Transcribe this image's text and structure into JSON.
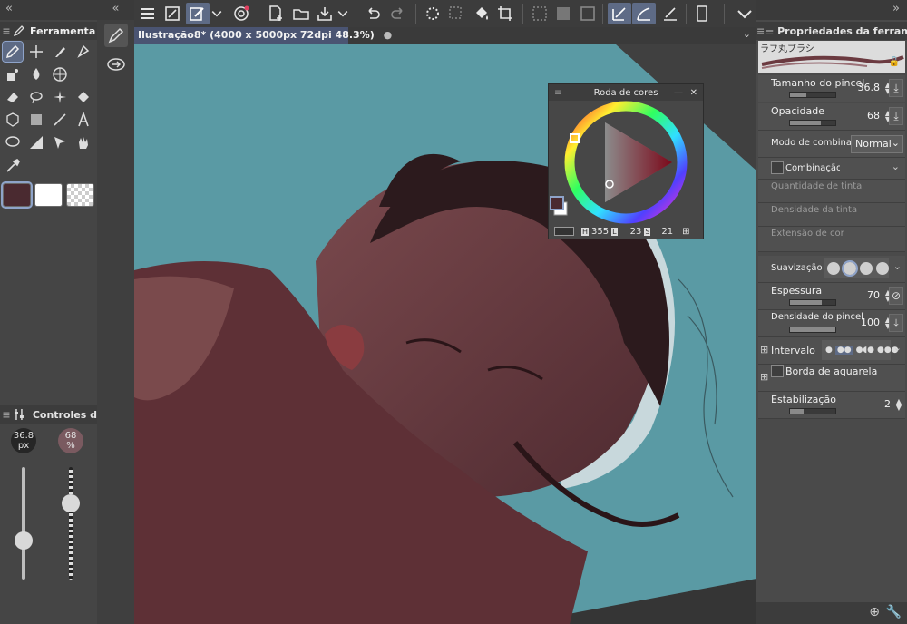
{
  "left_panel": {
    "tool_title": "Ferramenta",
    "controls_title": "Controles d",
    "brush_size": {
      "value": "36.8",
      "unit": "px",
      "fraction": 0.35
    },
    "opacity": {
      "value": "68",
      "unit": "%",
      "fraction": 0.68
    },
    "colors": {
      "main": "#4a2a30",
      "sub": "#ffffff"
    }
  },
  "document": {
    "tab_title": "Ilustração8* (4000 x 5000px 72dpi 48.3%)"
  },
  "color_wheel": {
    "title": "Roda de cores",
    "h_label": "H",
    "h_value": "355",
    "l_label": "L",
    "l_value": "23",
    "s_label": "S",
    "s_value": "21"
  },
  "properties": {
    "title": "Propriedades da ferramenta",
    "brush_name": "ラフ丸ブラシ",
    "items": {
      "brush_size": {
        "label": "Tamanho do pincel",
        "value": "36.8"
      },
      "opacity": {
        "label": "Opacidade",
        "value": "68"
      },
      "blend_mode": {
        "label": "Modo de combinação",
        "value": "Normal"
      },
      "color_blend": {
        "label": "Combinação de cor"
      },
      "paint_amount": {
        "label": "Quantidade de tinta"
      },
      "paint_density": {
        "label": "Densidade da tinta"
      },
      "color_stretch": {
        "label": "Extensão de cor"
      },
      "antialiasing": {
        "label": "Suavização de :"
      },
      "thickness": {
        "label": "Espessura",
        "value": "70"
      },
      "brush_density": {
        "label": "Densidade do pincel",
        "value": "100"
      },
      "interval": {
        "label": "Intervalo"
      },
      "watercolor_edge": {
        "label": "Borda de aquarela"
      },
      "stabilization": {
        "label": "Estabilização",
        "value": "2"
      }
    }
  },
  "colors": {
    "accent": "#5e6b86",
    "canvas_bg": "#5a9aa4",
    "skin": "#6b3a40"
  }
}
